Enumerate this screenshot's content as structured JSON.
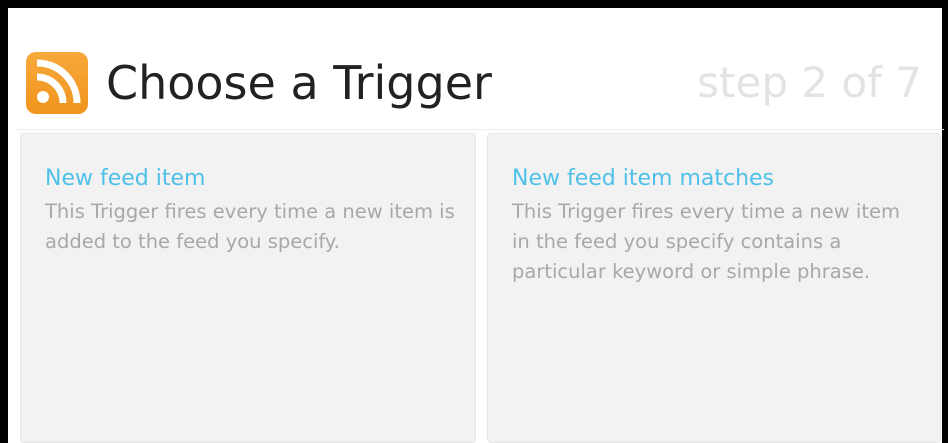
{
  "header": {
    "icon": "rss-feed-icon",
    "icon_color": "#f39a26",
    "title": "Choose a Trigger",
    "step": "step 2 of 7"
  },
  "triggers": [
    {
      "title": "New feed item",
      "description": "This Trigger fires every time a new item is added to the feed you specify."
    },
    {
      "title": "New feed item matches",
      "description": "This Trigger fires every time a new item in the feed you specify contains a particular keyword or simple phrase."
    }
  ],
  "colors": {
    "accent": "#4fc0e8",
    "card_bg": "#f2f2f2",
    "description_text": "#a8a8a8",
    "step_text": "#e3e3e3"
  }
}
